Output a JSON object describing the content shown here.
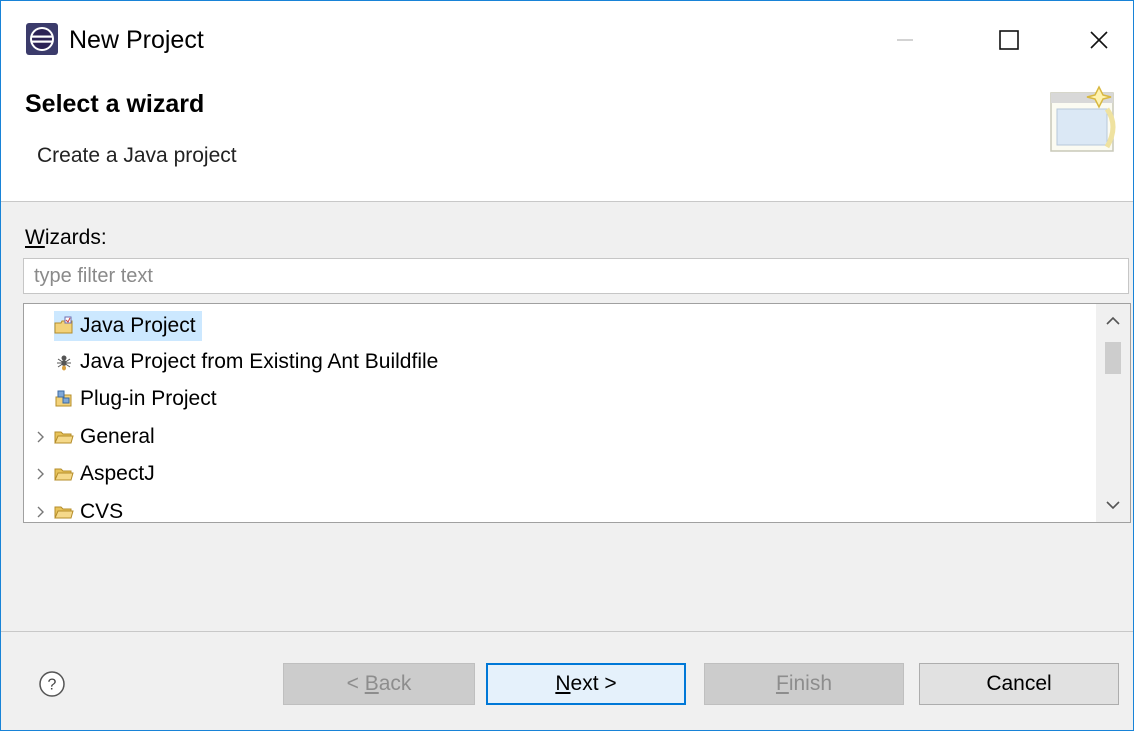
{
  "window": {
    "title": "New Project",
    "controls": [
      "minimize",
      "maximize",
      "close"
    ]
  },
  "header": {
    "heading": "Select a wizard",
    "description": "Create a Java project",
    "banner_icon": "wizard-banner-icon"
  },
  "wizards": {
    "label_mnemonic": "W",
    "label_rest": "izards:",
    "filter_placeholder": "type filter text",
    "filter_value": ""
  },
  "tree": {
    "items": [
      {
        "label": "Java Project",
        "icon": "java-project-icon",
        "expandable": false,
        "selected": true
      },
      {
        "label": "Java Project from Existing Ant Buildfile",
        "icon": "ant-icon",
        "expandable": false,
        "selected": false
      },
      {
        "label": "Plug-in Project",
        "icon": "plugin-project-icon",
        "expandable": false,
        "selected": false
      },
      {
        "label": "General",
        "icon": "folder-icon",
        "expandable": true,
        "selected": false
      },
      {
        "label": "AspectJ",
        "icon": "folder-icon",
        "expandable": true,
        "selected": false
      },
      {
        "label": "CVS",
        "icon": "folder-icon",
        "expandable": true,
        "selected": false
      }
    ]
  },
  "footer": {
    "help_icon": "help-icon",
    "back": {
      "prefix": "< ",
      "mnemonic": "B",
      "rest": "ack",
      "enabled": false
    },
    "next": {
      "mnemonic": "N",
      "rest": "ext >",
      "enabled": true,
      "default": true
    },
    "finish": {
      "mnemonic": "F",
      "rest": "inish",
      "enabled": false
    },
    "cancel": {
      "label": "Cancel",
      "enabled": true
    }
  },
  "colors": {
    "window_border": "#1883d7",
    "selection": "#cce8ff",
    "default_button_border": "#0078d7",
    "disabled_text": "#8d8d8d"
  }
}
